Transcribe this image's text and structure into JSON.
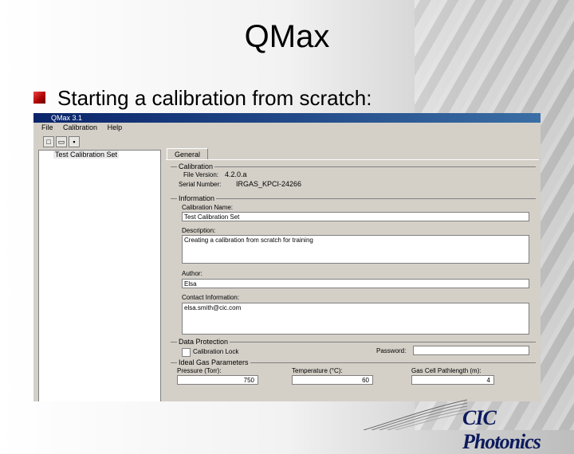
{
  "slide": {
    "title": "QMax",
    "bullet": "Starting a calibration from scratch:"
  },
  "window": {
    "title": "QMax 3.1",
    "menu": [
      "File",
      "Calibration",
      "Help"
    ],
    "toolbar_icons": [
      "new-file-icon",
      "open-folder-icon",
      "save-icon"
    ]
  },
  "tree": {
    "items": [
      "Test Calibration Set"
    ]
  },
  "tab": {
    "label": "General"
  },
  "calibration": {
    "group": "Calibration",
    "file_version_label": "File Version:",
    "file_version": "4.2.0.a",
    "serial_label": "Serial Number:",
    "serial": "IRGAS_KPCI-24266"
  },
  "information": {
    "group": "Information",
    "name_label": "Calibration Name:",
    "name": "Test Calibration Set",
    "description_label": "Description:",
    "description": "Creating a calibration from scratch for training",
    "author_label": "Author:",
    "author": "Elsa",
    "contact_label": "Contact Information:",
    "contact": "elsa.smith@cic.com"
  },
  "protection": {
    "group": "Data Protection",
    "lock_label": "Calibration Lock",
    "password_label": "Password:",
    "password": ""
  },
  "gas": {
    "group": "Ideal Gas Parameters",
    "pressure_label": "Pressure (Torr):",
    "pressure": "750",
    "temperature_label": "Temperature (°C):",
    "temperature": "60",
    "pathlength_label": "Gas Cell Pathlength (m):",
    "pathlength": "4"
  },
  "brand": {
    "logo": "CIC Photonics",
    "accent": "#0d1a5c"
  }
}
